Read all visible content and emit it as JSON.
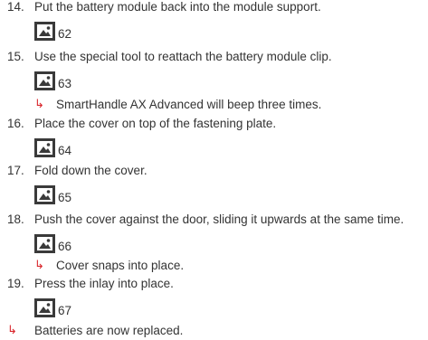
{
  "steps": [
    {
      "number": "14.",
      "text": "Put the battery module back into the module support.",
      "figure": "62"
    },
    {
      "number": "15.",
      "text": "Use the special tool to reattach the battery module clip.",
      "figure": "63",
      "result": "SmartHandle AX Advanced will beep three times."
    },
    {
      "number": "16.",
      "text": "Place the cover on top of the fastening plate.",
      "figure": "64"
    },
    {
      "number": "17.",
      "text": "Fold down the cover.",
      "figure": "65"
    },
    {
      "number": "18.",
      "text": "Push the cover against the door, sliding it upwards at the same time.",
      "figure": "66",
      "result": "Cover snaps into place."
    },
    {
      "number": "19.",
      "text": "Press the inlay into place.",
      "figure": "67"
    }
  ],
  "final_result": "Batteries are now replaced.",
  "icons": {
    "result_arrow": "result-arrow-icon",
    "figure_placeholder": "image-icon"
  },
  "colors": {
    "accent": "#d9262c",
    "text": "#333333",
    "figure_bg": "#3a3a3a"
  }
}
